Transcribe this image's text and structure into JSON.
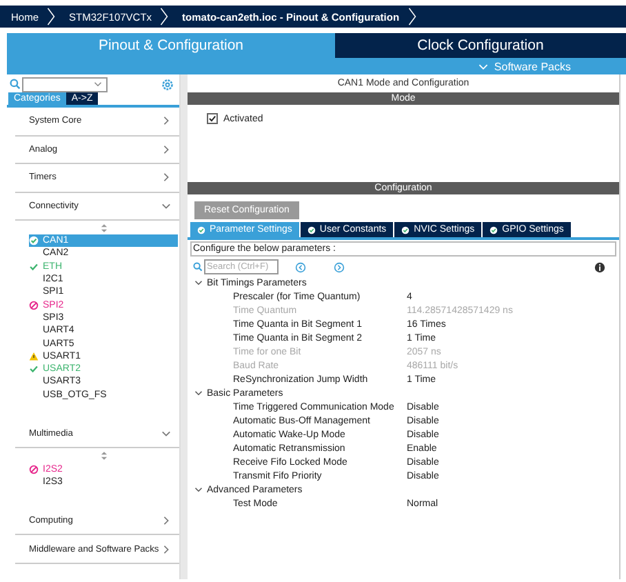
{
  "breadcrumbs": [
    {
      "label": "Home",
      "current": false
    },
    {
      "label": "STM32F107VCTx",
      "current": false
    },
    {
      "label": "tomato-can2eth.ioc - Pinout & Configuration",
      "current": true
    }
  ],
  "main_tabs": [
    {
      "label": "Pinout & Configuration",
      "selected": true
    },
    {
      "label": "Clock Configuration",
      "selected": false
    }
  ],
  "software_packs": "Software Packs",
  "sidebar": {
    "view_tabs": [
      {
        "label": "Categories",
        "selected": true
      },
      {
        "label": "A->Z",
        "selected": false
      }
    ],
    "categories": [
      {
        "label": "System Core",
        "expanded": false
      },
      {
        "label": "Analog",
        "expanded": false
      },
      {
        "label": "Timers",
        "expanded": false
      },
      {
        "label": "Connectivity",
        "expanded": true,
        "items": [
          {
            "label": "CAN1",
            "kind": "ok",
            "selected": true
          },
          {
            "label": "CAN2",
            "kind": "plain",
            "selected": false
          },
          {
            "label": "ETH",
            "kind": "ok",
            "selected": false
          },
          {
            "label": "I2C1",
            "kind": "plain",
            "selected": false
          },
          {
            "label": "SPI1",
            "kind": "plain",
            "selected": false
          },
          {
            "label": "SPI2",
            "kind": "error",
            "selected": false
          },
          {
            "label": "SPI3",
            "kind": "plain",
            "selected": false
          },
          {
            "label": "UART4",
            "kind": "plain",
            "selected": false
          },
          {
            "label": "UART5",
            "kind": "plain",
            "selected": false
          },
          {
            "label": "USART1",
            "kind": "warning",
            "selected": false
          },
          {
            "label": "USART2",
            "kind": "ok",
            "selected": false
          },
          {
            "label": "USART3",
            "kind": "plain",
            "selected": false
          },
          {
            "label": "USB_OTG_FS",
            "kind": "plain",
            "selected": false
          }
        ]
      },
      {
        "label": "Multimedia",
        "expanded": true,
        "items": [
          {
            "label": "I2S2",
            "kind": "error",
            "selected": false
          },
          {
            "label": "I2S3",
            "kind": "plain",
            "selected": false
          }
        ]
      },
      {
        "label": "Computing",
        "expanded": false
      },
      {
        "label": "Middleware and Software Packs",
        "expanded": false
      }
    ]
  },
  "panel_title": "CAN1 Mode and Configuration",
  "mode": {
    "header": "Mode",
    "activated": {
      "label": "Activated",
      "checked": true
    }
  },
  "configuration": {
    "header": "Configuration",
    "reset_button": "Reset Configuration",
    "tabs": [
      {
        "label": "Parameter Settings",
        "selected": true
      },
      {
        "label": "User Constants",
        "selected": false
      },
      {
        "label": "NVIC Settings",
        "selected": false
      },
      {
        "label": "GPIO Settings",
        "selected": false
      }
    ],
    "hint": "Configure the below parameters :",
    "search": {
      "placeholder": "Search (Ctrl+F)"
    },
    "groups": [
      {
        "label": "Bit Timings Parameters",
        "expanded": true,
        "params": [
          {
            "name": "Prescaler (for Time Quantum)",
            "value": "4",
            "disabled": false
          },
          {
            "name": "Time Quantum",
            "value": "114.28571428571429 ns",
            "disabled": true
          },
          {
            "name": "Time Quanta in Bit Segment 1",
            "value": "16 Times",
            "disabled": false
          },
          {
            "name": "Time Quanta in Bit Segment 2",
            "value": "1 Time",
            "disabled": false
          },
          {
            "name": "Time for one Bit",
            "value": "2057 ns",
            "disabled": true
          },
          {
            "name": "Baud Rate",
            "value": "486111 bit/s",
            "disabled": true
          },
          {
            "name": "ReSynchronization Jump Width",
            "value": "1 Time",
            "disabled": false
          }
        ]
      },
      {
        "label": "Basic Parameters",
        "expanded": true,
        "params": [
          {
            "name": "Time Triggered Communication Mode",
            "value": "Disable",
            "disabled": false
          },
          {
            "name": "Automatic Bus-Off Management",
            "value": "Disable",
            "disabled": false
          },
          {
            "name": "Automatic Wake-Up Mode",
            "value": "Disable",
            "disabled": false
          },
          {
            "name": "Automatic Retransmission",
            "value": "Enable",
            "disabled": false
          },
          {
            "name": "Receive Fifo Locked Mode",
            "value": "Disable",
            "disabled": false
          },
          {
            "name": "Transmit Fifo Priority",
            "value": "Disable",
            "disabled": false
          }
        ]
      },
      {
        "label": "Advanced Parameters",
        "expanded": true,
        "params": [
          {
            "name": "Test Mode",
            "value": "Normal",
            "disabled": false
          }
        ]
      }
    ]
  }
}
